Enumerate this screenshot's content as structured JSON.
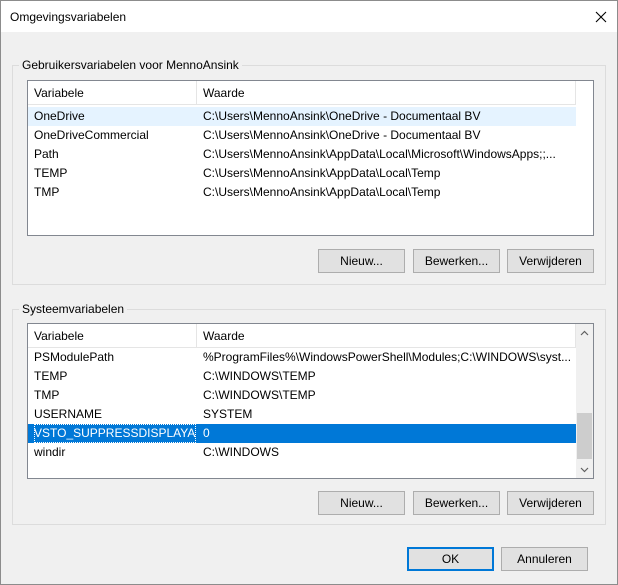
{
  "window": {
    "title": "Omgevingsvariabelen"
  },
  "user_group": {
    "label": "Gebruikersvariabelen voor MennoAnsink",
    "columns": [
      "Variabele",
      "Waarde"
    ],
    "rows": [
      {
        "name": "OneDrive",
        "value": "C:\\Users\\MennoAnsink\\OneDrive - Documentaal BV"
      },
      {
        "name": "OneDriveCommercial",
        "value": "C:\\Users\\MennoAnsink\\OneDrive - Documentaal BV"
      },
      {
        "name": "Path",
        "value": "C:\\Users\\MennoAnsink\\AppData\\Local\\Microsoft\\WindowsApps;;..."
      },
      {
        "name": "TEMP",
        "value": "C:\\Users\\MennoAnsink\\AppData\\Local\\Temp"
      },
      {
        "name": "TMP",
        "value": "C:\\Users\\MennoAnsink\\AppData\\Local\\Temp"
      }
    ],
    "buttons": {
      "new": "Nieuw...",
      "edit": "Bewerken...",
      "delete": "Verwijderen"
    }
  },
  "system_group": {
    "label": "Systeemvariabelen",
    "columns": [
      "Variabele",
      "Waarde"
    ],
    "rows": [
      {
        "name": "PSModulePath",
        "value": "%ProgramFiles%\\WindowsPowerShell\\Modules;C:\\WINDOWS\\syst..."
      },
      {
        "name": "TEMP",
        "value": "C:\\WINDOWS\\TEMP"
      },
      {
        "name": "TMP",
        "value": "C:\\WINDOWS\\TEMP"
      },
      {
        "name": "USERNAME",
        "value": "SYSTEM"
      },
      {
        "name": "VSTO_SUPPRESSDISPLAYALE...",
        "value": "0"
      },
      {
        "name": "windir",
        "value": "C:\\WINDOWS"
      }
    ],
    "buttons": {
      "new": "Nieuw...",
      "edit": "Bewerken...",
      "delete": "Verwijderen"
    }
  },
  "footer": {
    "ok": "OK",
    "cancel": "Annuleren"
  },
  "colors": {
    "selection": "#0078d7",
    "hover": "#e5f3ff",
    "accent_border": "#0078d7"
  }
}
